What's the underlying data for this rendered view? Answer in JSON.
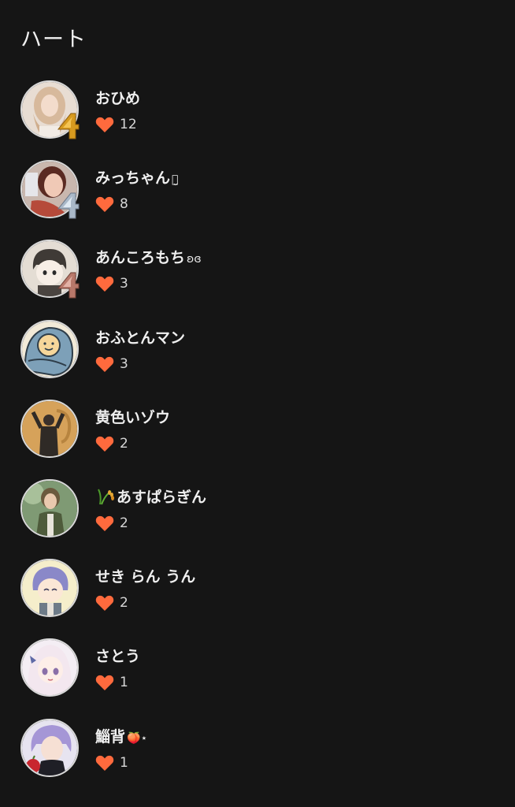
{
  "header": {
    "title": "ハート"
  },
  "colors": {
    "background": "#151515",
    "heart": "#ff6a3d",
    "text": "#efefef"
  },
  "users": [
    {
      "name": "おひめ",
      "decoration": "",
      "prefix_icon": "",
      "hearts": "12",
      "avatar": "blonde-girl-portrait",
      "badge": "gold-balloon-4"
    },
    {
      "name": "みっちゃん",
      "decoration": "ꪔ̤̮",
      "prefix_icon": "",
      "hearts": "8",
      "avatar": "woman-selfie-portrait",
      "badge": "silver-balloon-4"
    },
    {
      "name": "あんころもち",
      "decoration": "ʚɞ",
      "prefix_icon": "",
      "hearts": "3",
      "avatar": "illustrated-boy-face",
      "badge": "rose-gold-balloon-4"
    },
    {
      "name": "おふとんマン",
      "decoration": "",
      "prefix_icon": "",
      "hearts": "3",
      "avatar": "blanket-character",
      "badge": ""
    },
    {
      "name": "黄色いゾウ",
      "decoration": "",
      "prefix_icon": "",
      "hearts": "2",
      "avatar": "person-on-mustard-background",
      "badge": ""
    },
    {
      "name": "あすぱらぎん",
      "decoration": "",
      "prefix_icon": "rice-plant-icon",
      "hearts": "2",
      "avatar": "anime-man-green-vest",
      "badge": ""
    },
    {
      "name": "せき らん うん",
      "decoration": "",
      "prefix_icon": "",
      "hearts": "2",
      "avatar": "purple-hair-chibi",
      "badge": ""
    },
    {
      "name": "さとう",
      "decoration": "",
      "prefix_icon": "",
      "hearts": "1",
      "avatar": "anime-girl-white-hair",
      "badge": ""
    },
    {
      "name": "鯔背",
      "decoration": "🍑⋆",
      "prefix_icon": "",
      "hearts": "1",
      "avatar": "anime-man-purple-hair",
      "badge": ""
    }
  ]
}
